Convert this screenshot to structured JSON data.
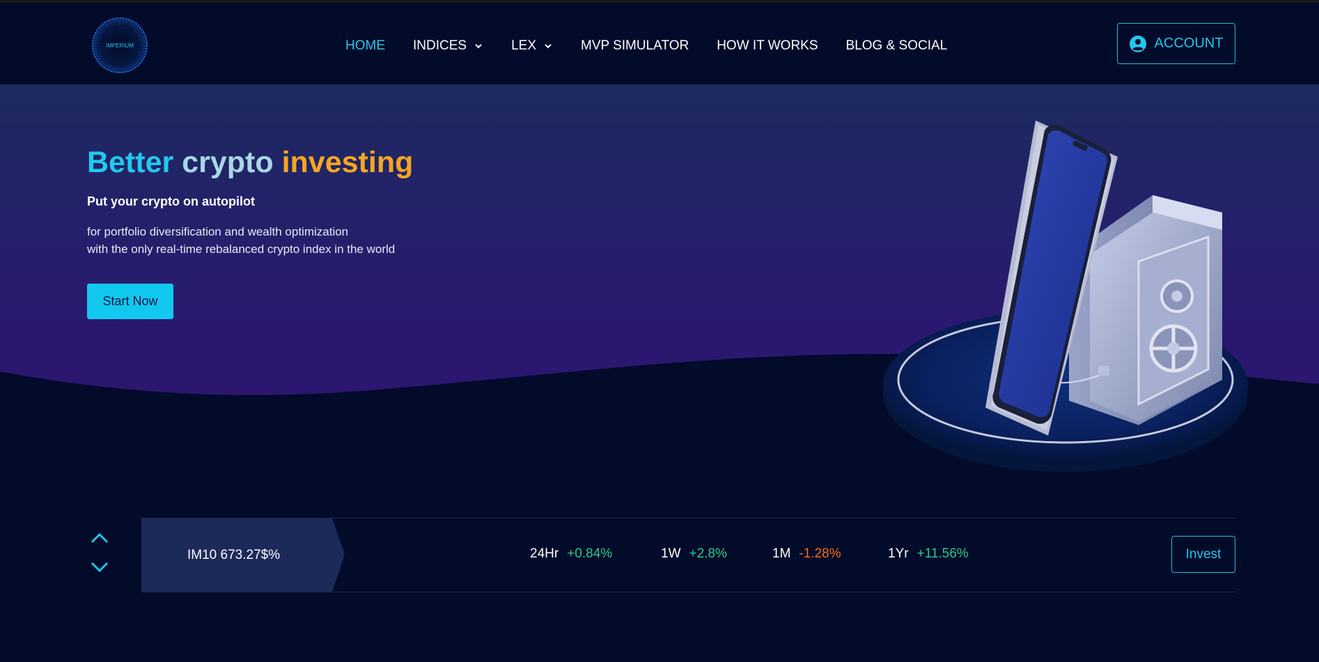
{
  "header": {
    "logo_text": "IMPERIUM",
    "nav": [
      {
        "label": "HOME",
        "active": true
      },
      {
        "label": "INDICES",
        "dropdown": true
      },
      {
        "label": "LEX",
        "dropdown": true
      },
      {
        "label": "MVP SIMULATOR"
      },
      {
        "label": "HOW IT WORKS"
      },
      {
        "label": "BLOG & SOCIAL"
      }
    ],
    "account_label": "ACCOUNT"
  },
  "hero": {
    "title_part1": "Better",
    "title_part2": "crypto",
    "title_part3": "investing",
    "subtitle": "Put your crypto on autopilot",
    "desc_line1": "for portfolio diversification and wealth optimization",
    "desc_line2": "with the only real-time rebalanced crypto index in the world",
    "cta": "Start Now"
  },
  "ticker": {
    "name": "IM10 673.27$%",
    "stats": [
      {
        "label": "24Hr",
        "value": "+0.84%",
        "trend": "pos"
      },
      {
        "label": "1W",
        "value": "+2.8%",
        "trend": "pos"
      },
      {
        "label": "1M",
        "value": "-1.28%",
        "trend": "neg"
      },
      {
        "label": "1Yr",
        "value": "+11.56%",
        "trend": "pos"
      }
    ],
    "invest_label": "Invest"
  },
  "colors": {
    "accent": "#22c6ea",
    "orange": "#f4a623",
    "positive": "#2cc98a",
    "negative": "#f26b1d",
    "background": "#020b2a"
  },
  "icons": [
    "logo-ring-icon",
    "chevron-down-icon",
    "user-circle-icon",
    "arrow-up-icon",
    "arrow-down-icon"
  ]
}
